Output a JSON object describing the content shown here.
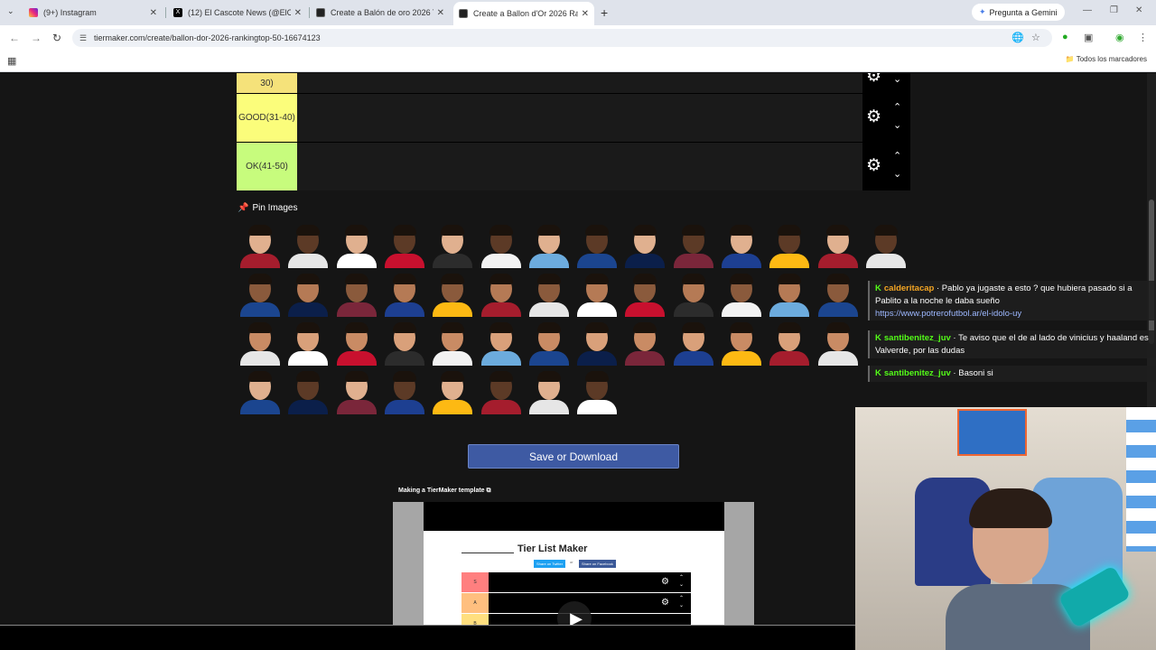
{
  "browser": {
    "tabs": [
      {
        "title": "(9+) Instagram",
        "active": false
      },
      {
        "title": "(12) El Cascote News (@ElCascote",
        "active": false
      },
      {
        "title": "Create a Balón de oro 2026 Tier",
        "active": false
      },
      {
        "title": "Create a Ballon d'Or 2026 Rank",
        "active": true
      }
    ],
    "gemini_label": "Pregunta a Gemini",
    "url": "tiermaker.com/create/ballon-dor-2026-rankingtop-50-16674123",
    "all_bookmarks_label": "Todos los marcadores"
  },
  "tiers": [
    {
      "label": "30)",
      "color": "#f5e27a"
    },
    {
      "label": "GOOD(31-40)",
      "color": "#fbfd7b"
    },
    {
      "label": "OK(41-50)",
      "color": "#c7fc7d"
    }
  ],
  "pin_images_label": "Pin Images",
  "player_rows": [
    14,
    13,
    13,
    8
  ],
  "save_button_label": "Save or Download",
  "video": {
    "title": "Making a TierMaker template",
    "inner_title": "Tier List Maker",
    "share_twitter": "Share on Twitter",
    "share_or": "or",
    "share_facebook": "Share on Facebook",
    "mini_tiers": [
      "S",
      "A",
      "B"
    ]
  },
  "chat": [
    {
      "user": "calderitacap",
      "text": "Pablo ya jugaste a esto ? que hubiera pasado si a Pablito a la noche le daba sueño",
      "link": "https://www.potrerofutbol.ar/el-idolo-uy"
    },
    {
      "user": "santibenitez_juv",
      "text": "Te aviso que el de al lado de vinicius y haaland es Valverde, por las dudas",
      "link": ""
    },
    {
      "user": "santibenitez_juv",
      "text": "Basoni si",
      "link": ""
    }
  ]
}
